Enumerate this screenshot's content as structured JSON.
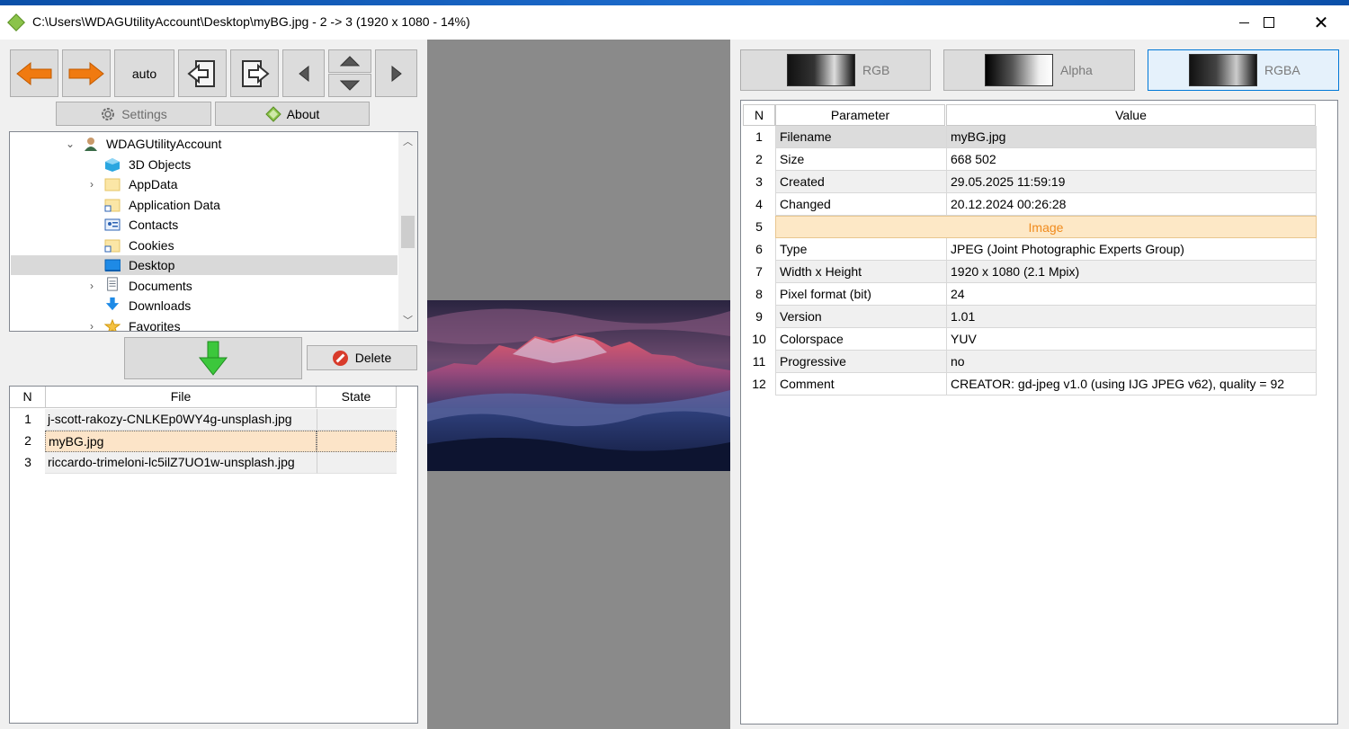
{
  "window": {
    "title": "C:\\Users\\WDAGUtilityAccount\\Desktop\\myBG.jpg - 2 -> 3 (1920 x 1080 - 14%)",
    "close_glyph": "✕"
  },
  "toolbar": {
    "auto_label": "auto",
    "settings_label": "Settings",
    "about_label": "About",
    "delete_label": "Delete"
  },
  "tree": {
    "items": [
      {
        "label": "WDAGUtilityAccount",
        "icon": "user-icon",
        "expanded": true
      },
      {
        "label": "3D Objects",
        "icon": "3d-objects-icon"
      },
      {
        "label": "AppData",
        "icon": "folder-icon",
        "expandable": true
      },
      {
        "label": "Application Data",
        "icon": "shortcut-folder-icon"
      },
      {
        "label": "Contacts",
        "icon": "contacts-icon"
      },
      {
        "label": "Cookies",
        "icon": "shortcut-folder-icon"
      },
      {
        "label": "Desktop",
        "icon": "desktop-icon",
        "selected": true
      },
      {
        "label": "Documents",
        "icon": "documents-icon",
        "expandable": true
      },
      {
        "label": "Downloads",
        "icon": "downloads-icon"
      },
      {
        "label": "Favorites",
        "icon": "favorites-icon",
        "expandable": true
      }
    ]
  },
  "filelist": {
    "headers": {
      "n": "N",
      "file": "File",
      "state": "State"
    },
    "rows": [
      {
        "n": "1",
        "file": "j-scott-rakozy-CNLKEp0WY4g-unsplash.jpg",
        "state": ""
      },
      {
        "n": "2",
        "file": "myBG.jpg",
        "state": "",
        "selected": true
      },
      {
        "n": "3",
        "file": "riccardo-trimeloni-lc5ilZ7UO1w-unsplash.jpg",
        "state": ""
      }
    ]
  },
  "channels": {
    "tabs": [
      {
        "label": "RGB",
        "active": false
      },
      {
        "label": "Alpha",
        "active": false
      },
      {
        "label": "RGBA",
        "active": true
      }
    ]
  },
  "properties": {
    "headers": {
      "n": "N",
      "parameter": "Parameter",
      "value": "Value"
    },
    "rows": [
      {
        "n": "1",
        "parameter": "Filename",
        "value": "myBG.jpg"
      },
      {
        "n": "2",
        "parameter": "Size",
        "value": "668 502"
      },
      {
        "n": "3",
        "parameter": "Created",
        "value": "29.05.2025 11:59:19"
      },
      {
        "n": "4",
        "parameter": "Changed",
        "value": "20.12.2024 00:26:28"
      },
      {
        "n": "5",
        "section": "Image"
      },
      {
        "n": "6",
        "parameter": "Type",
        "value": "JPEG (Joint Photographic Experts Group)"
      },
      {
        "n": "7",
        "parameter": "Width x Height",
        "value": "1920 x 1080 (2.1 Mpix)"
      },
      {
        "n": "8",
        "parameter": "Pixel format (bit)",
        "value": "24"
      },
      {
        "n": "9",
        "parameter": "Version",
        "value": "1.01"
      },
      {
        "n": "10",
        "parameter": "Colorspace",
        "value": "YUV"
      },
      {
        "n": "11",
        "parameter": "Progressive",
        "value": "no"
      },
      {
        "n": "12",
        "parameter": "Comment",
        "value": "CREATOR: gd-jpeg v1.0 (using IJG JPEG v62), quality = 92"
      }
    ]
  },
  "colors": {
    "accent": "#0078d7",
    "section_text": "#f08a1c",
    "selection": "#fce4c8"
  }
}
